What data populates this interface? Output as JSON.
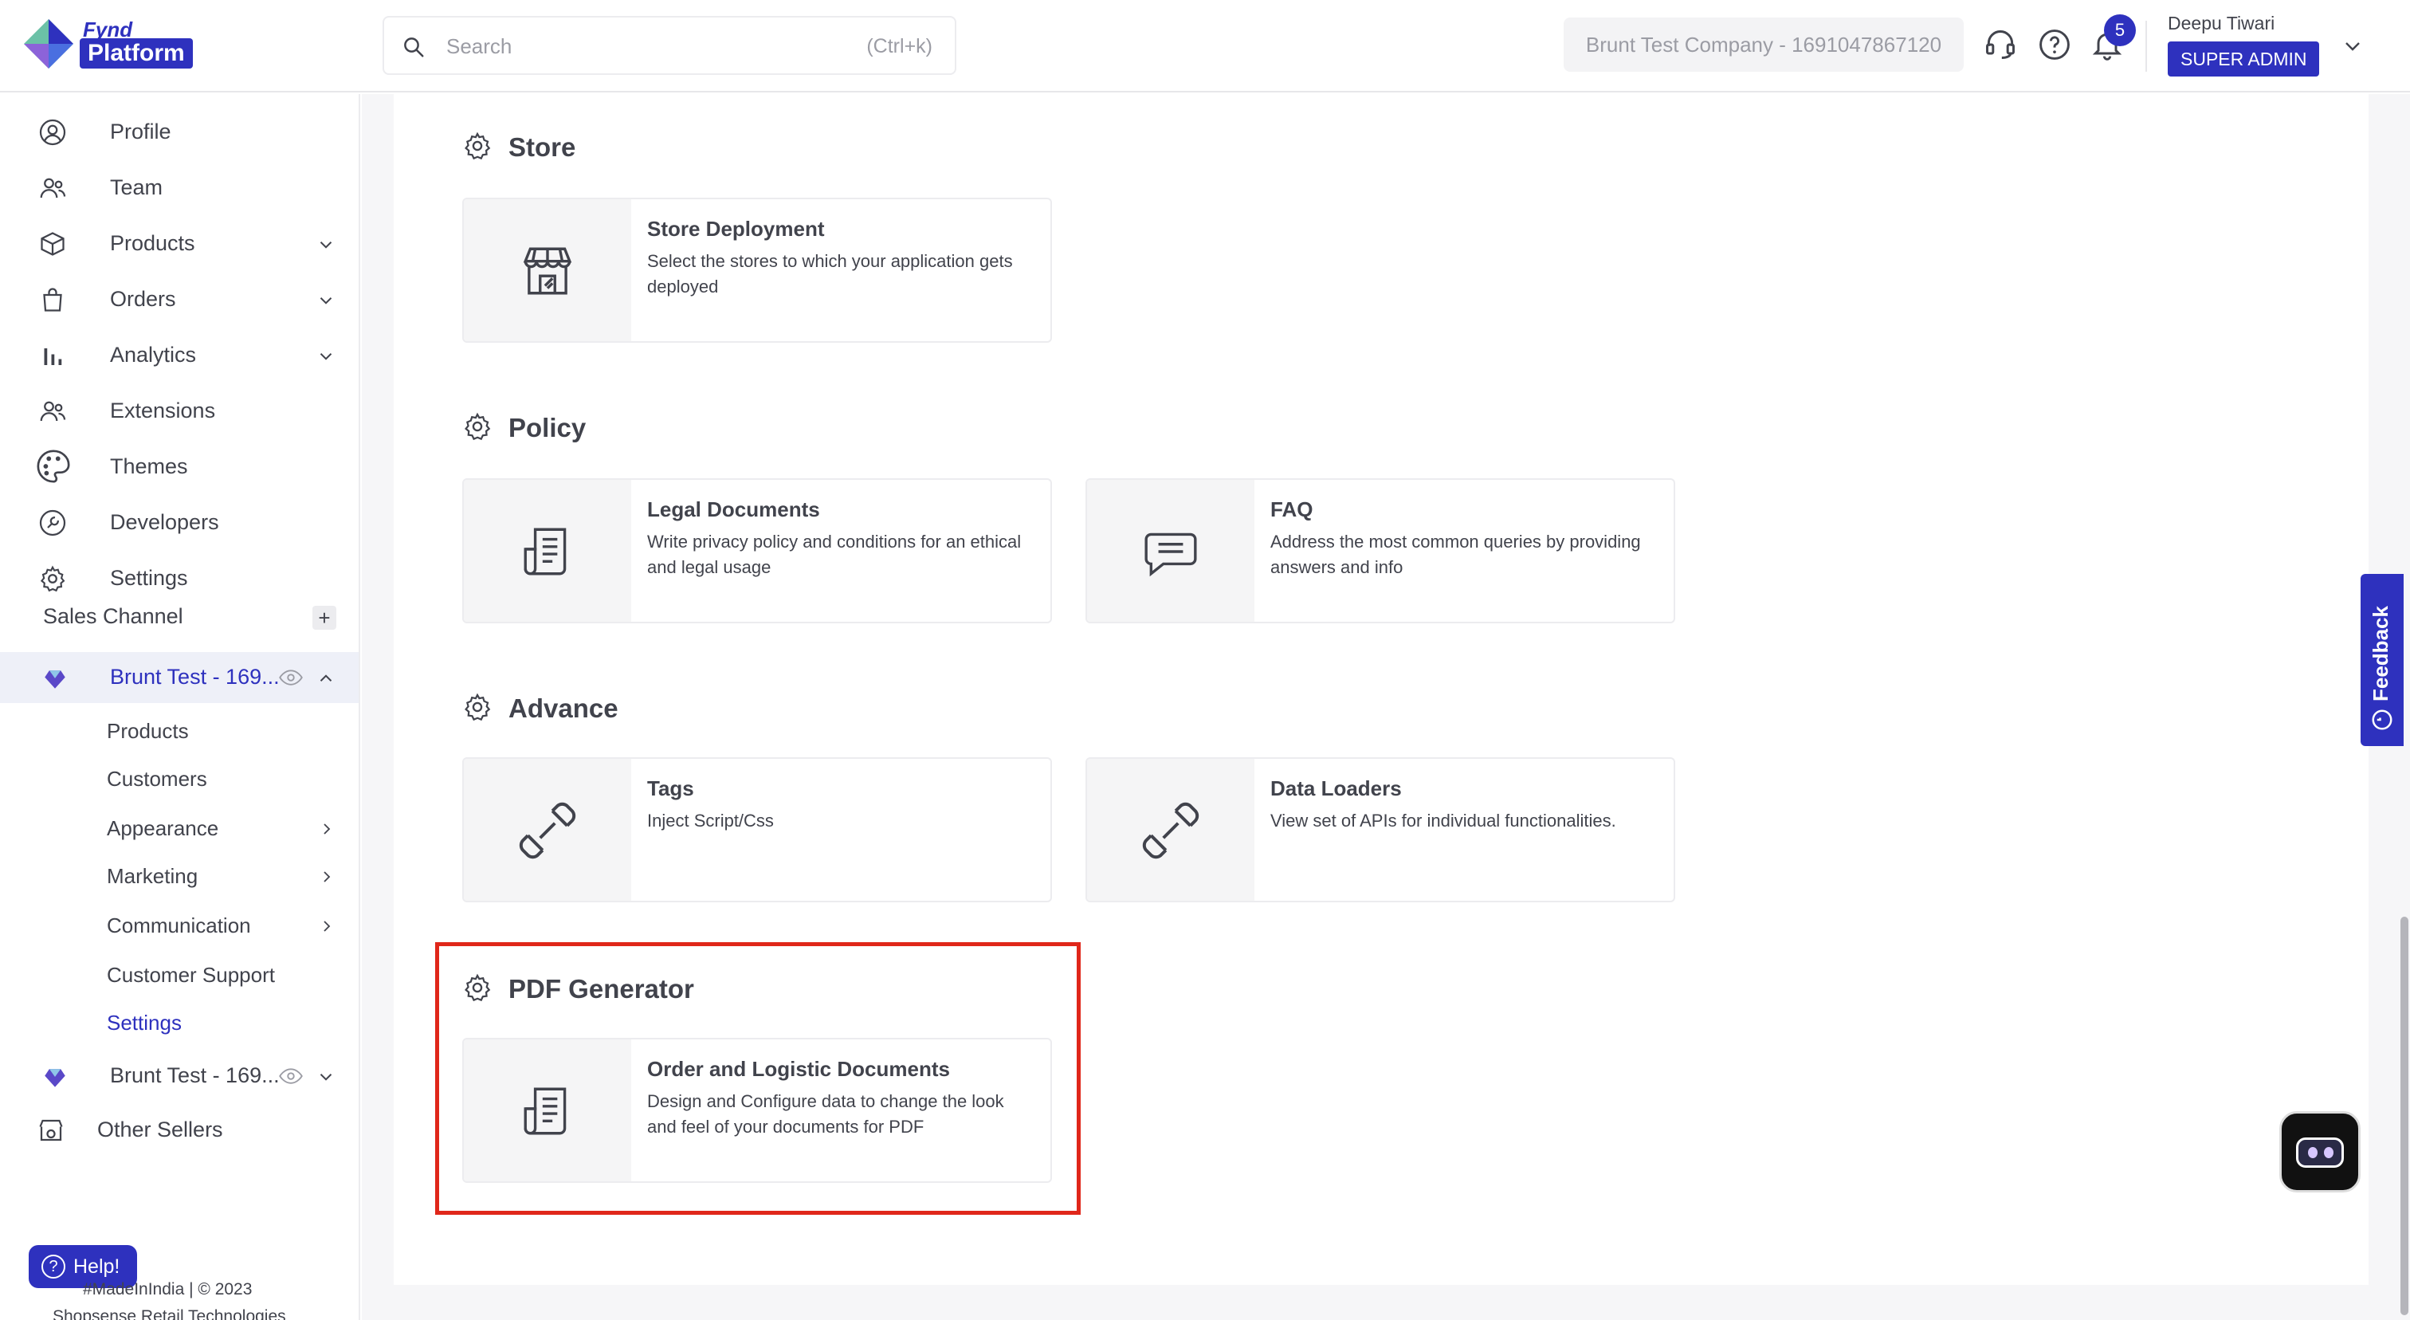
{
  "header": {
    "logo_top": "Fynd",
    "logo_bottom": "Platform",
    "search_placeholder": "Search",
    "search_shortcut": "(Ctrl+k)",
    "company": "Brunt Test Company - 1691047867120",
    "notification_count": "5",
    "user_name": "Deepu Tiwari",
    "user_role": "SUPER ADMIN"
  },
  "sidebar": {
    "items": [
      {
        "label": "Profile",
        "icon": "profile-icon"
      },
      {
        "label": "Team",
        "icon": "team-icon"
      },
      {
        "label": "Products",
        "icon": "products-icon"
      },
      {
        "label": "Orders",
        "icon": "orders-icon"
      },
      {
        "label": "Analytics",
        "icon": "analytics-icon"
      },
      {
        "label": "Extensions",
        "icon": "extensions-icon"
      },
      {
        "label": "Themes",
        "icon": "themes-icon"
      },
      {
        "label": "Developers",
        "icon": "developers-icon"
      },
      {
        "label": "Settings",
        "icon": "settings-icon"
      }
    ],
    "sales_channel_label": "Sales Channel",
    "sales_channel_add": "+",
    "channel_1": "Brunt Test - 169...",
    "channel_1_sub": [
      "Products",
      "Customers",
      "Appearance",
      "Marketing",
      "Communication",
      "Customer Support",
      "Settings"
    ],
    "channel_2": "Brunt Test - 169...",
    "other_sellers": "Other Sellers",
    "help_label": "Help!",
    "footer_line1": "#MadeInIndia | © 2023",
    "footer_line2": "Shopsense Retail Technologies"
  },
  "sections": [
    {
      "title": "Store",
      "cards": [
        {
          "title": "Store Deployment",
          "desc": "Select the stores to which your application gets deployed",
          "icon": "store-icon"
        }
      ]
    },
    {
      "title": "Policy",
      "cards": [
        {
          "title": "Legal Documents",
          "desc": "Write privacy policy and conditions for an ethical and legal usage",
          "icon": "document-icon"
        },
        {
          "title": "FAQ",
          "desc": "Address the most common queries by providing answers and info",
          "icon": "chat-bubble-icon"
        }
      ]
    },
    {
      "title": "Advance",
      "cards": [
        {
          "title": "Tags",
          "desc": "Inject Script/Css",
          "icon": "link-icon"
        },
        {
          "title": "Data Loaders",
          "desc": "View set of APIs for individual functionalities.",
          "icon": "link-icon"
        }
      ]
    },
    {
      "title": "PDF Generator",
      "cards": [
        {
          "title": "Order and Logistic Documents",
          "desc": "Design and Configure data to change the look and feel of your documents for PDF",
          "icon": "document-icon"
        }
      ]
    }
  ],
  "widgets": {
    "feedback_label": "Feedback"
  },
  "colors": {
    "brand": "#2e31be",
    "highlight": "#e0271a",
    "text": "#41434c"
  }
}
